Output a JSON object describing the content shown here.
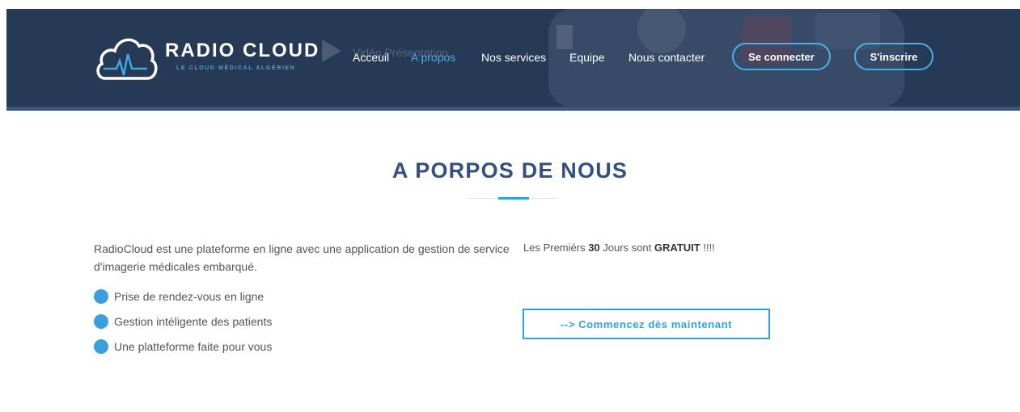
{
  "header": {
    "logo_title": "RADIO CLOUD",
    "logo_subtitle": "LE CLOUD MÉDICAL ALGÉRIEN",
    "video_label": "Vidéo Présentation",
    "nav": {
      "accueil": "Acceuil",
      "apropos": "A propos",
      "services": "Nos services",
      "equipe": "Equipe",
      "contact": "Nous contacter"
    },
    "login_label": "Se connecter",
    "signup_label": "S'inscrire"
  },
  "section": {
    "title": "A PORPOS DE NOUS",
    "intro": "RadioCloud est une plateforme en ligne avec une application de gestion de service d'imagerie médicales embarqué.",
    "features": [
      "Prise de rendez-vous en ligne",
      "Gestion intéligente des patients",
      "Une platteforme faite pour vous"
    ],
    "promo": {
      "prefix": "Les Premiérs",
      "days": "30",
      "middle": "Jours sont",
      "free": "GRATUIT",
      "suffix": "!!!!"
    },
    "cta_label": "--> Commencez dès maintenant"
  },
  "colors": {
    "header_bg": "#263955",
    "accent": "#2aa6dc",
    "title": "#34507e"
  },
  "icons": {
    "logo": "cloud-heartbeat-icon",
    "video": "play-icon",
    "bullet": "circle-dot-icon"
  }
}
